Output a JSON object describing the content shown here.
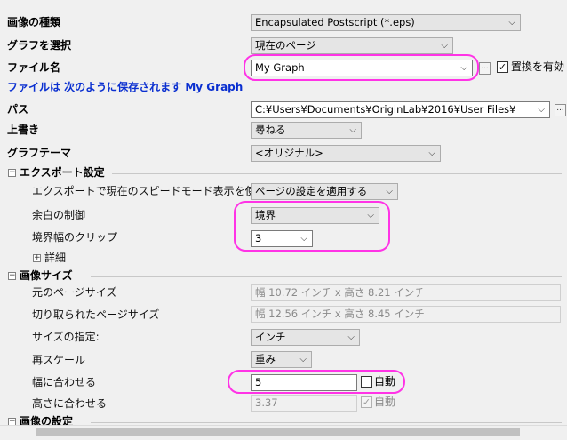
{
  "rows": {
    "image_type": {
      "label": "画像の種類",
      "value": "Encapsulated Postscript (*.eps)"
    },
    "select_graph": {
      "label": "グラフを選択",
      "value": "現在のページ"
    },
    "file_name": {
      "label": "ファイル名",
      "value": "My Graph",
      "browse": "...",
      "overwrite_label": "置換を有効",
      "overwrite_checked": true
    },
    "save_note": "ファイルは 次のように保存されます My Graph",
    "path": {
      "label": "パス",
      "value": "C:¥Users¥Documents¥OriginLab¥2016¥User Files¥",
      "browse": "..."
    },
    "overwrite": {
      "label": "上書き",
      "value": "尋ねる"
    },
    "theme": {
      "label": "グラフテーマ",
      "value": "<オリジナル>"
    }
  },
  "export_section": {
    "title": "エクスポート設定",
    "toggle": "−",
    "speed_mode": {
      "label": "エクスポートで現在のスピードモード表示を使う",
      "value": "ページの設定を適用する"
    },
    "margin": {
      "label": "余白の制御",
      "value": "境界"
    },
    "clip": {
      "label": "境界幅のクリップ",
      "value": "3"
    },
    "details": {
      "label": "詳細",
      "toggle": "+"
    }
  },
  "size_section": {
    "title": "画像サイズ",
    "toggle": "−",
    "orig_size": {
      "label": "元のページサイズ",
      "value": "幅 10.72 インチ x 高さ 8.21 インチ"
    },
    "crop_size": {
      "label": "切り取られたページサイズ",
      "value": "幅 12.56 インチ x 高さ 8.45 インチ"
    },
    "unit": {
      "label": "サイズの指定:",
      "value": "インチ"
    },
    "rescale": {
      "label": "再スケール",
      "value": "重み"
    },
    "fit_width": {
      "label": "幅に合わせる",
      "value": "5",
      "auto_label": "自動",
      "auto_checked": false
    },
    "fit_height": {
      "label": "高さに合わせる",
      "value": "3.37",
      "auto_label": "自動",
      "auto_checked": true
    }
  },
  "image_settings_section": {
    "title": "画像の設定",
    "toggle": "−"
  },
  "highlight_color": "#ff33e6",
  "note_color": "#0a2fd0"
}
